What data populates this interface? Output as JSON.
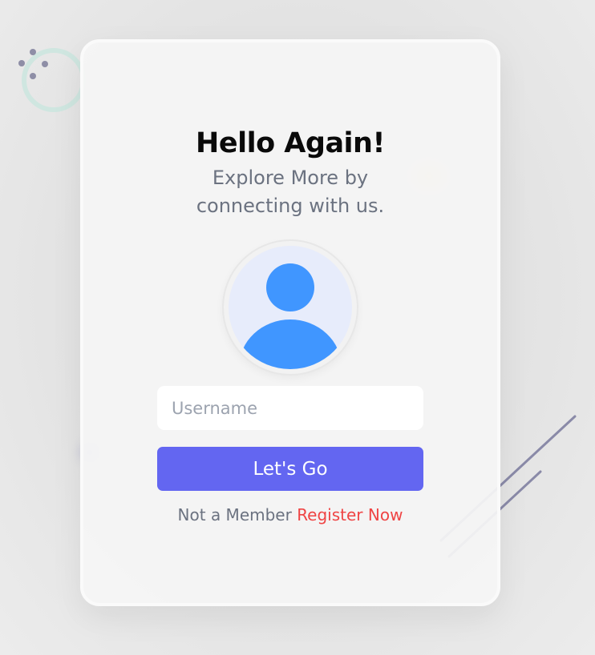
{
  "login": {
    "title": "Hello Again!",
    "subtitle": "Explore More by connecting with us.",
    "username_placeholder": "Username",
    "submit_label": "Let's Go",
    "register_prompt": "Not a Member",
    "register_link": "Register Now"
  },
  "colors": {
    "button": "#6366f1",
    "link": "#ef4444",
    "avatar_figure": "#4096ff",
    "avatar_background": "#e7ecfb"
  },
  "icons": {
    "avatar": "user-avatar-icon"
  }
}
